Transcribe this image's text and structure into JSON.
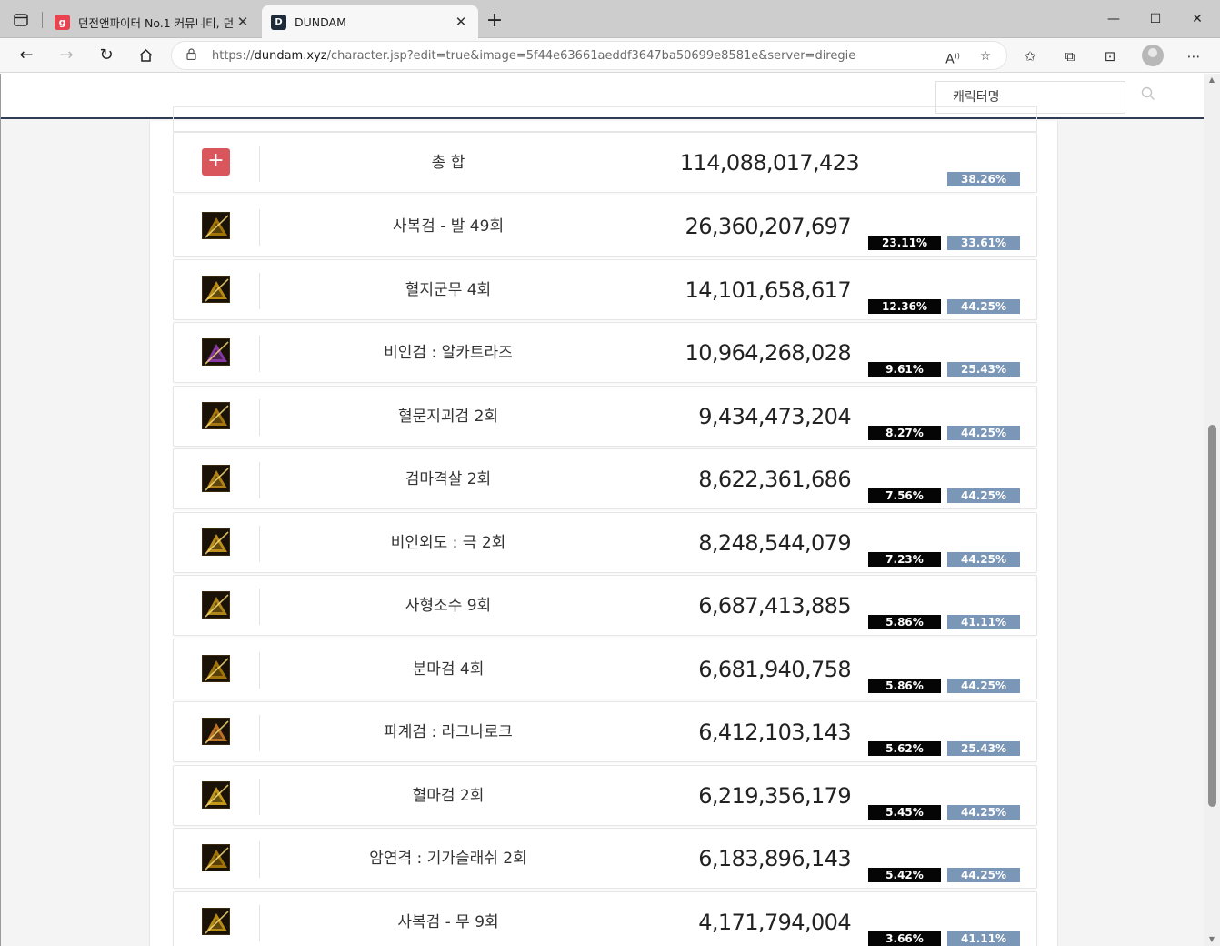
{
  "browser": {
    "tabs": [
      {
        "title": "던전앤파이터 No.1 커뮤니티, 던",
        "favicon": "g",
        "active": false
      },
      {
        "title": "DUNDAM",
        "favicon": "D",
        "active": true
      }
    ],
    "url_prefix": "https://",
    "url_domain": "dundam.xyz",
    "url_path": "/character.jsp?edit=true&image=5f44e63661aeddf3647ba50699e8581e&server=diregie"
  },
  "site": {
    "search_placeholder": "캐릭터명"
  },
  "total": {
    "name": "총 합",
    "damage": "114,088,017,423",
    "rate": "38.26%"
  },
  "skills": [
    {
      "name": "사복검 - 발 49회",
      "damage": "26,360,207,697",
      "share": "23.11%",
      "rate": "33.61%",
      "icon": "dagger-burst-skill-icon",
      "color": "#b8860b"
    },
    {
      "name": "혈지군무 4회",
      "damage": "14,101,658,617",
      "share": "12.36%",
      "rate": "44.25%",
      "icon": "blade-dance-skill-icon",
      "color": "#d4a017"
    },
    {
      "name": "비인검 : 알카트라즈",
      "damage": "10,964,268,028",
      "share": "9.61%",
      "rate": "25.43%",
      "icon": "purple-blade-skill-icon",
      "color": "#9b3fbf"
    },
    {
      "name": "혈문지괴검 2회",
      "damage": "9,434,473,204",
      "share": "8.27%",
      "rate": "44.25%",
      "icon": "crossed-blades-skill-icon",
      "color": "#c08a12"
    },
    {
      "name": "검마격살 2회",
      "damage": "8,622,361,686",
      "share": "7.56%",
      "rate": "44.25%",
      "icon": "sword-slash-skill-icon",
      "color": "#c9941a"
    },
    {
      "name": "비인외도 : 극 2회",
      "damage": "8,248,544,079",
      "share": "7.23%",
      "rate": "44.25%",
      "icon": "flame-sword-skill-icon",
      "color": "#d9a420"
    },
    {
      "name": "사형조수 9회",
      "damage": "6,687,413,885",
      "share": "5.86%",
      "rate": "41.11%",
      "icon": "whip-lash-skill-icon",
      "color": "#c89a1c"
    },
    {
      "name": "분마검 4회",
      "damage": "6,681,940,758",
      "share": "5.86%",
      "rate": "44.25%",
      "icon": "split-blade-skill-icon",
      "color": "#b8860b"
    },
    {
      "name": "파계검 : 라그나로크",
      "damage": "6,412,103,143",
      "share": "5.62%",
      "rate": "25.43%",
      "icon": "ragnarok-blade-skill-icon",
      "color": "#d9822b"
    },
    {
      "name": "혈마검 2회",
      "damage": "6,219,356,179",
      "share": "5.45%",
      "rate": "44.25%",
      "icon": "blood-sword-skill-icon",
      "color": "#e0b020"
    },
    {
      "name": "암연격 : 기가슬래쉬 2회",
      "damage": "6,183,896,143",
      "share": "5.42%",
      "rate": "44.25%",
      "icon": "giga-slash-skill-icon",
      "color": "#b8860b"
    },
    {
      "name": "사복검 - 무 9회",
      "damage": "4,171,794,004",
      "share": "3.66%",
      "rate": "41.11%",
      "icon": "serpent-blade-skill-icon",
      "color": "#d4a017"
    }
  ]
}
